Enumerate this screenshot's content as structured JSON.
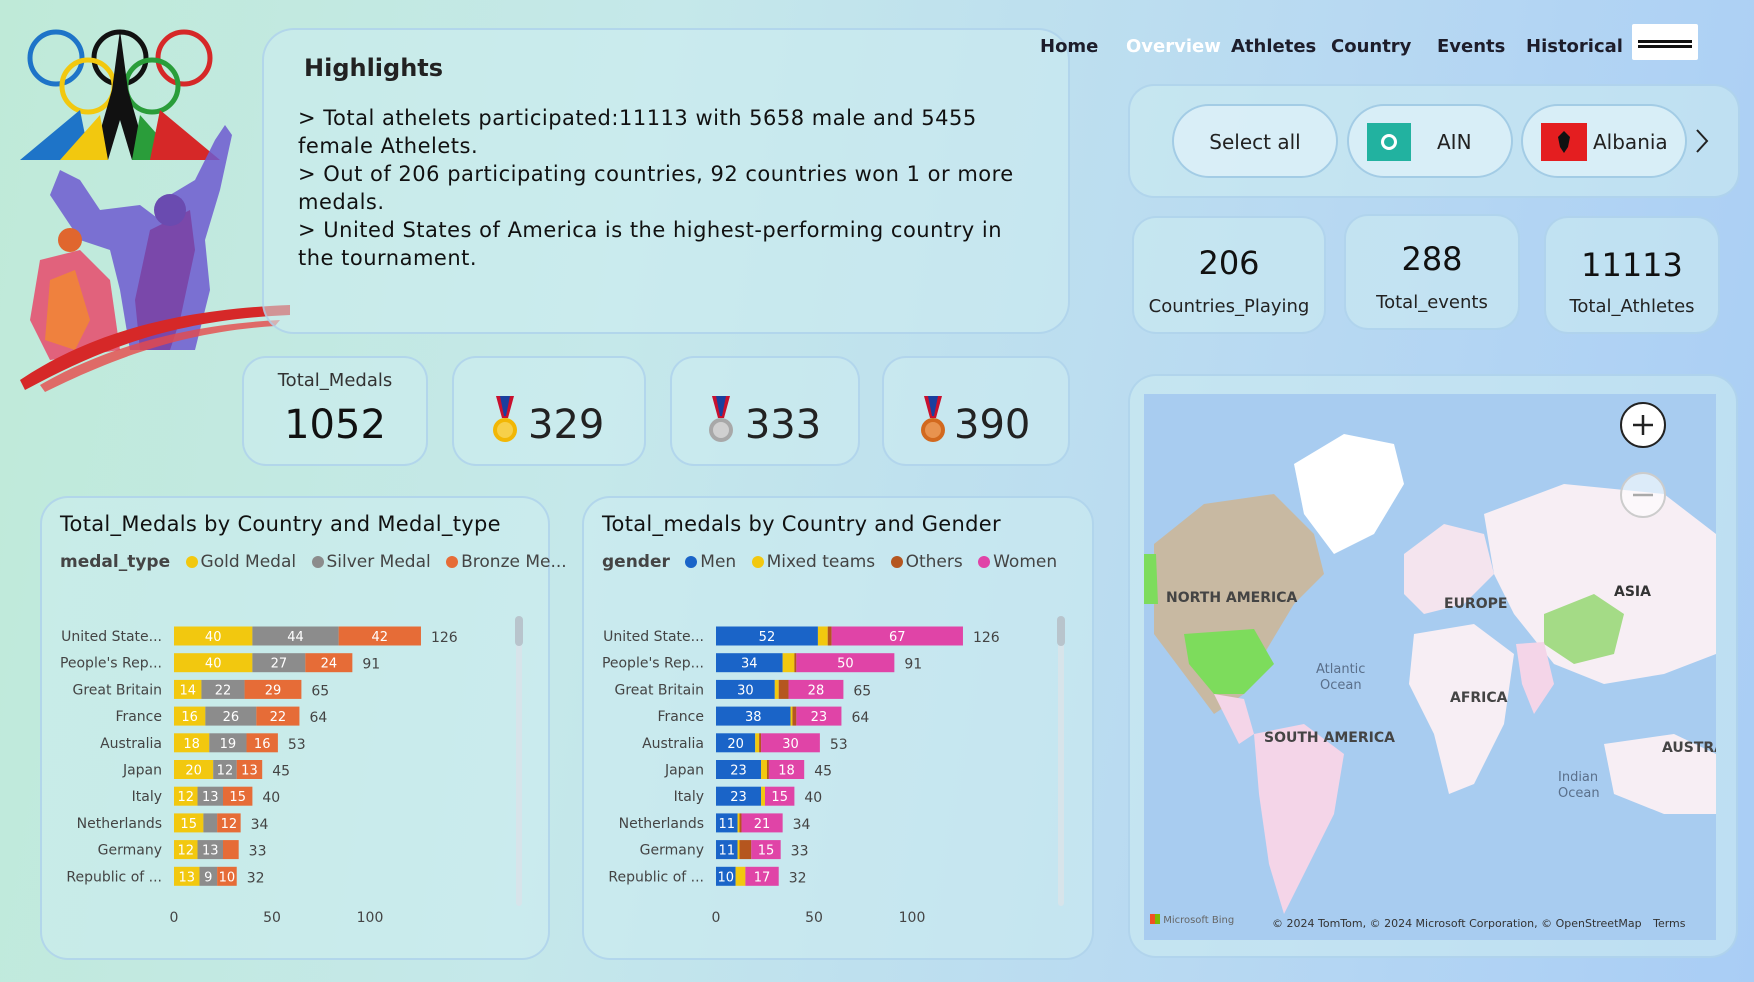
{
  "nav": {
    "items": [
      "Home",
      "Overview",
      "Athletes",
      "Country",
      "Events",
      "Historical"
    ],
    "active": "Overview"
  },
  "highlights": {
    "title": "Highlights",
    "lines": [
      "> Total athelets participated:11113 with 5658 male and 5455",
      "female Athelets.",
      "> Out of 206 participating countries, 92 countries won 1 or more",
      "medals.",
      "> United States of America is the highest-performing country in",
      "the tournament."
    ]
  },
  "medals": {
    "total_label": "Total_Medals",
    "total": "1052",
    "gold": "329",
    "silver": "333",
    "bronze": "390"
  },
  "slicer": {
    "items": [
      "Select all",
      "AIN",
      "Albania"
    ]
  },
  "kpis": [
    {
      "value": "206",
      "label": "Countries_Playing"
    },
    {
      "value": "288",
      "label": "Total_events"
    },
    {
      "value": "11113",
      "label": "Total_Athletes"
    }
  ],
  "colors": {
    "gold": "#f2c80f",
    "silver": "#8c8c8c",
    "bronze": "#e66c37",
    "men": "#1a64c8",
    "mixed": "#f2c80f",
    "others": "#b5561f",
    "women": "#e044a7"
  },
  "chart_data": [
    {
      "type": "bar",
      "orientation": "horizontal",
      "stacked": true,
      "title": "Total_Medals by Country and Medal_type",
      "legend_title": "medal_type",
      "legend": [
        "Gold Medal",
        "Silver Medal",
        "Bronze Me..."
      ],
      "categories": [
        "United State...",
        "People's Rep...",
        "Great Britain",
        "France",
        "Australia",
        "Japan",
        "Italy",
        "Netherlands",
        "Germany",
        "Republic of ..."
      ],
      "series": [
        {
          "name": "Gold Medal",
          "values": [
            40,
            40,
            14,
            16,
            18,
            20,
            12,
            15,
            12,
            13
          ]
        },
        {
          "name": "Silver Medal",
          "values": [
            44,
            27,
            22,
            26,
            19,
            12,
            13,
            7,
            13,
            9
          ]
        },
        {
          "name": "Bronze Medal",
          "values": [
            42,
            24,
            29,
            22,
            16,
            13,
            15,
            12,
            8,
            10
          ]
        }
      ],
      "totals": [
        126,
        91,
        65,
        64,
        53,
        45,
        40,
        34,
        33,
        32
      ],
      "xticks": [
        "0",
        "50",
        "100"
      ],
      "xlim": [
        0,
        125
      ]
    },
    {
      "type": "bar",
      "orientation": "horizontal",
      "stacked": true,
      "title": "Total_medals by Country and Gender",
      "legend_title": "gender",
      "legend": [
        "Men",
        "Mixed teams",
        "Others",
        "Women"
      ],
      "categories": [
        "United State...",
        "People's Rep...",
        "Great Britain",
        "France",
        "Australia",
        "Japan",
        "Italy",
        "Netherlands",
        "Germany",
        "Republic of ..."
      ],
      "series": [
        {
          "name": "Men",
          "values": [
            52,
            34,
            30,
            38,
            20,
            23,
            23,
            11,
            11,
            10
          ]
        },
        {
          "name": "Mixed teams",
          "values": [
            5,
            6,
            2,
            1,
            2,
            3,
            2,
            1,
            1,
            5
          ]
        },
        {
          "name": "Others",
          "values": [
            2,
            1,
            5,
            2,
            1,
            1,
            0,
            1,
            6,
            0
          ]
        },
        {
          "name": "Women",
          "values": [
            67,
            50,
            28,
            23,
            30,
            18,
            15,
            21,
            15,
            17
          ]
        }
      ],
      "totals": [
        126,
        91,
        65,
        64,
        53,
        45,
        40,
        34,
        33,
        32
      ],
      "xticks": [
        "0",
        "50",
        "100"
      ],
      "xlim": [
        0,
        125
      ]
    }
  ],
  "map": {
    "labels": [
      "NORTH AMERICA",
      "EUROPE",
      "ASIA",
      "Atlantic",
      "Ocean",
      "AFRICA",
      "SOUTH AMERICA",
      "Indian",
      "Ocean",
      "AUSTRA"
    ],
    "brand": "Microsoft Bing",
    "attribution": "© 2024 TomTom, © 2024 Microsoft Corporation, © OpenStreetMap",
    "terms": "Terms"
  }
}
